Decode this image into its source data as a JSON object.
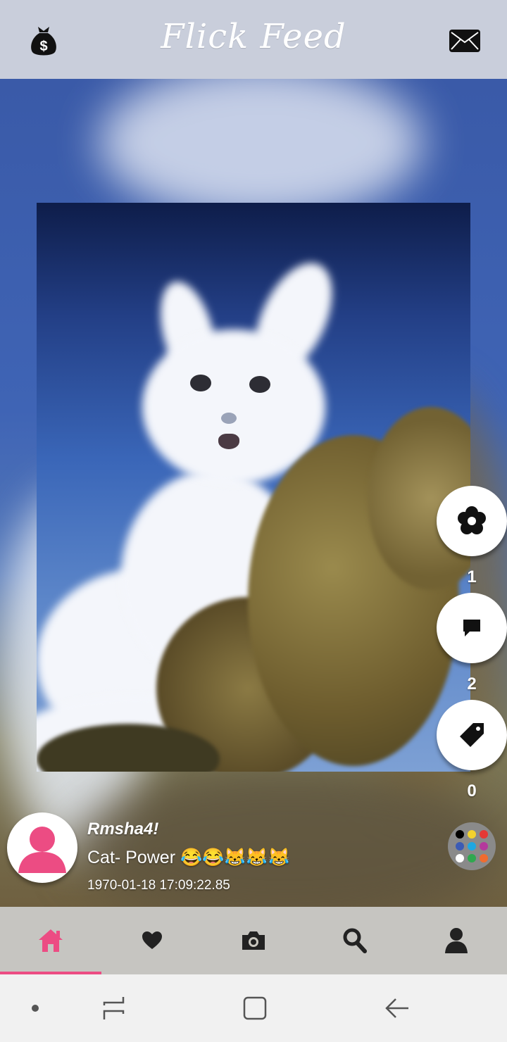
{
  "app": {
    "title": "Flick Feed"
  },
  "header": {
    "left_icon": "money-bag-icon",
    "right_icon": "mail-icon"
  },
  "post": {
    "username": "Rmsha4!",
    "caption": "Cat- Power 😂😂😹😹😹",
    "timestamp": "1970-01-18 17:09:22.85"
  },
  "actions": [
    {
      "icon": "flower-icon",
      "count": "1"
    },
    {
      "icon": "comment-icon",
      "count": "2"
    },
    {
      "icon": "tag-icon",
      "count": "0"
    }
  ],
  "palette": {
    "icon": "color-palette-icon",
    "dot_colors": [
      "#000000",
      "#f2d22e",
      "#e53935",
      "#3b5bb5",
      "#1ea7e1",
      "#b43a9c",
      "#ffffff",
      "#2fa84f",
      "#ef6c2f"
    ]
  },
  "bottom_nav": {
    "items": [
      "home-icon",
      "heart-icon",
      "camera-icon",
      "search-icon",
      "profile-icon"
    ],
    "active_index": 0,
    "active_color": "#ec4c83",
    "inactive_color": "#222222"
  },
  "system_nav": {
    "items": [
      "dot-icon",
      "recent-apps-icon",
      "home-square-icon",
      "back-icon"
    ]
  }
}
